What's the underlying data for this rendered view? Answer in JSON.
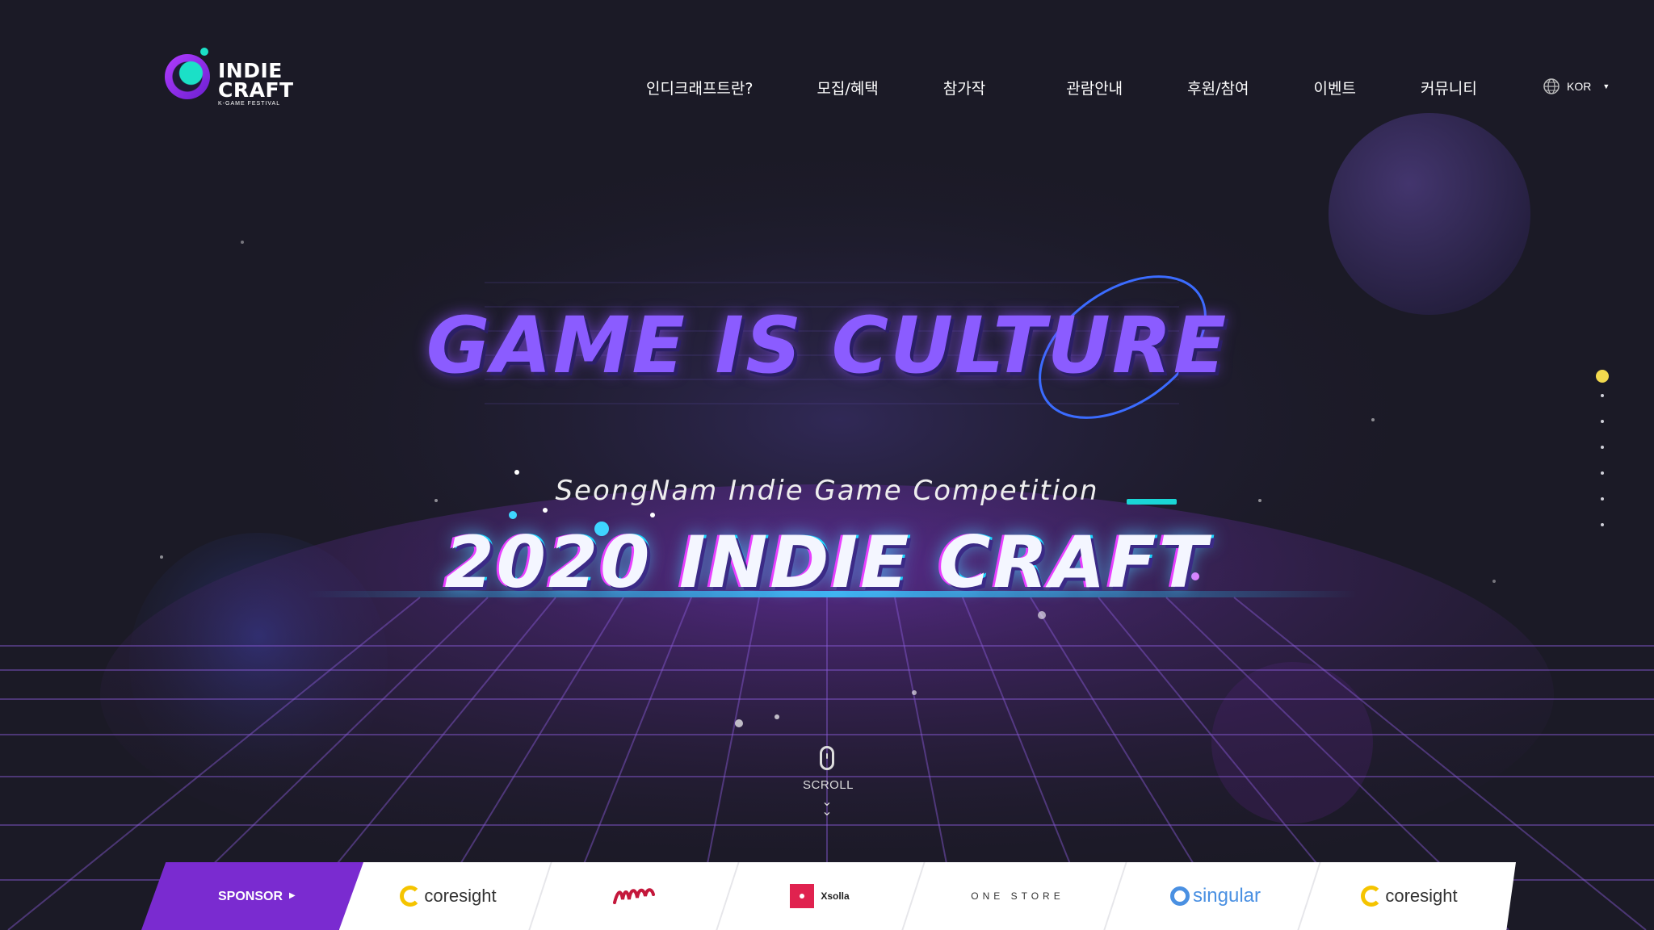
{
  "header": {
    "logo": {
      "line1": "INDIE",
      "line2": "CRAFT",
      "sub": "K-GAME FESTIVAL"
    },
    "nav": [
      {
        "label": "인디크래프트란?"
      },
      {
        "label": "모집/혜택"
      },
      {
        "label": "참가작"
      },
      {
        "label": "관람안내"
      },
      {
        "label": "후원/참여"
      },
      {
        "label": "이벤트"
      },
      {
        "label": "커뮤니티"
      }
    ],
    "language": {
      "label": "KOR",
      "icon": "globe-icon"
    }
  },
  "hero": {
    "headline": "GAME IS CULTURE",
    "subtitle": "SeongNam Indie Game Competition",
    "title": "2020 INDIE CRAFT",
    "scroll_label": "SCROLL"
  },
  "side_nav": {
    "count": 8,
    "active_index": 0,
    "active_color": "#f2d94e"
  },
  "sponsors": {
    "label": "SPONSOR",
    "logos": [
      {
        "name": "coresight",
        "text": "coresight"
      },
      {
        "name": "seongnam-foundation",
        "text": ""
      },
      {
        "name": "xsolla",
        "text": "Xsolla"
      },
      {
        "name": "onestore",
        "text": "ONE STORE"
      },
      {
        "name": "singular",
        "text": "singular"
      },
      {
        "name": "coresight",
        "text": "coresight"
      }
    ]
  },
  "colors": {
    "background": "#1b1a26",
    "accent_purple": "#7a2bd0",
    "accent_cyan": "#1ad6d6",
    "headline_purple": "#8b5cff"
  }
}
